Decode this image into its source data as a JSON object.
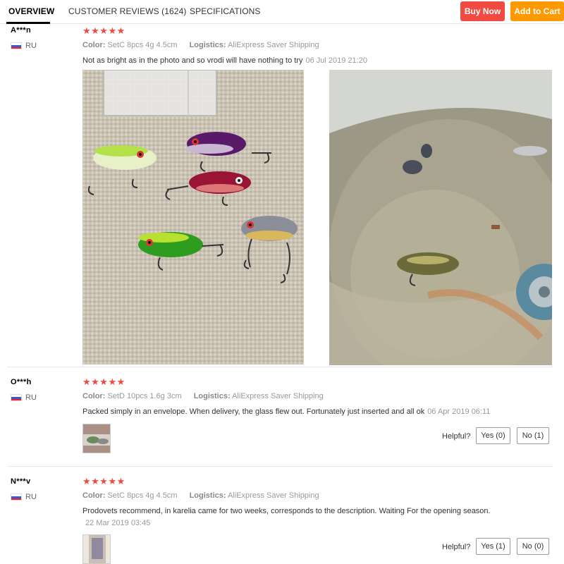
{
  "tabs": [
    {
      "label": "OVERVIEW",
      "active": true
    },
    {
      "label": "CUSTOMER REVIEWS (1624)",
      "active": false
    },
    {
      "label": "SPECIFICATIONS",
      "active": false
    }
  ],
  "actions": {
    "buy_now": "Buy Now",
    "add_to_cart": "Add to Cart"
  },
  "colors": {
    "buy_now": "#f04a41",
    "add_to_cart": "#ff9900",
    "stars": "#f04a41"
  },
  "labels": {
    "color": "Color:",
    "logistics": "Logistics:",
    "helpful": "Helpful?"
  },
  "reviews": [
    {
      "user": "A***n",
      "country": "RU",
      "stars": "★★★★★",
      "color_value": "SetC 8pcs 4g 4.5cm",
      "logistics_value": "AliExpress Saver Shipping",
      "text": "Not as bright as in the photo and so vrodi will have nothing to try",
      "date": "06 Jul 2019 21:20",
      "photos": [
        "lures-on-towel-photo",
        "lures-in-water-photo"
      ]
    },
    {
      "user": "O***h",
      "country": "RU",
      "stars": "★★★★★",
      "color_value": "SetD 10pcs 1.6g 3cm",
      "logistics_value": "AliExpress Saver Shipping",
      "text": "Packed simply in an envelope. When delivery, the glass flew out. Fortunately just inserted and all ok",
      "date": "06 Apr 2019 06:11",
      "yes": "Yes (0)",
      "no": "No (1)"
    },
    {
      "user": "N***v",
      "country": "RU",
      "stars": "★★★★★",
      "color_value": "SetC 8pcs 4g 4.5cm",
      "logistics_value": "AliExpress Saver Shipping",
      "text": "Prodovets recommend, in karelia came for two weeks, corresponds to the description. Waiting For the opening season.",
      "date": "22 Mar 2019 03:45",
      "yes": "Yes (1)",
      "no": "No (0)"
    }
  ]
}
